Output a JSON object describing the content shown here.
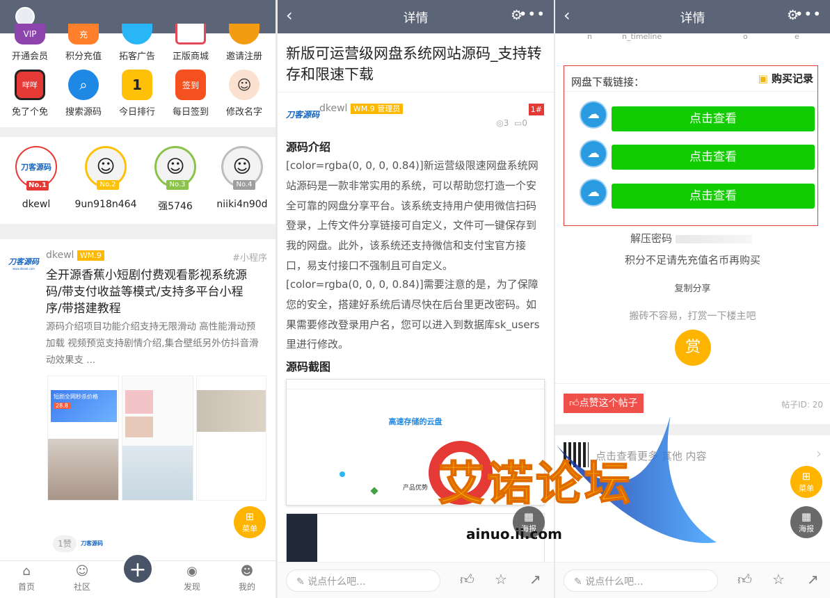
{
  "panel1": {
    "grid_row1": [
      "开通会员",
      "积分充值",
      "拓客广告",
      "正版商城",
      "邀请注册"
    ],
    "grid_row2": [
      "免了个免",
      "搜索源码",
      "今日排行",
      "每日签到",
      "修改名字"
    ],
    "ranking": [
      {
        "name": "dkewl",
        "no": "No.1",
        "avatar_text": "刀客源码"
      },
      {
        "name": "9un918n464",
        "no": "No.2"
      },
      {
        "name": "强5746",
        "no": "No.3"
      },
      {
        "name": "niiki4n90d",
        "no": "No.4"
      }
    ],
    "post": {
      "author": "dkewl",
      "badge": "WM.9",
      "tag": "#小程序",
      "logo_text": "刀客源码",
      "logo_sub": "www.dkewl.com",
      "title": "全开源香蕉小短剧付费观看影视系统源码/带支付收益等模式/支持多平台小程序/带搭建教程",
      "excerpt": "源码介绍项目功能介绍支持无限滑动 高性能滑动预加载 视频预览支持剧情介绍,集合壁纸另外仿抖音滑动效果支 ...",
      "thumb_banner": "短剧全网秒杀价格",
      "thumb_price": "28.8",
      "like": "1赞"
    },
    "fab_menu": "菜单",
    "tabs": [
      "首页",
      "社区",
      "发现",
      "我的"
    ],
    "tab_add": "+"
  },
  "panel2": {
    "header_title": "详情",
    "title": "新版可运营级网盘系统网站源码_支持转存和限速下载",
    "author": "dkewl",
    "author_badge": "WM.9 管理员",
    "floor": "1#",
    "views": "3",
    "comments": "0",
    "section1": "源码介绍",
    "para1": "[color=rgba(0, 0, 0, 0.84)]新运营级限速网盘系统网站源码是一款非常实用的系统，可以帮助您打造一个安全可靠的网盘分享平台。该系统支持用户使用微信扫码登录，上传文件分享链接可自定义，文件可一键保存到我的网盘。此外，该系统还支持微信和支付宝官方接口，易支付接口不强制且可自定义。",
    "para2": "[color=rgba(0, 0, 0, 0.84)]需要注意的是，为了保障您的安全，搭建好系统后请尽快在后台里更改密码。如果需要修改登录用户名，您可以进入到数据库sk_users里进行修改。",
    "section2": "源码截图",
    "shot_heading": "高速存储的云盘",
    "shot_product": "产品优势",
    "fab_poster": "海报",
    "comment_placeholder": "说点什么吧..."
  },
  "panel3": {
    "header_title": "详情",
    "cols": [
      "n",
      "n_timeline",
      "o",
      "e"
    ],
    "link_label": "网盘下载链接：",
    "buy_record": "购买记录",
    "view_btn": [
      "点击查看",
      "点击查看",
      "点击查看"
    ],
    "unzip": "解压密码",
    "notice": "积分不足请先充值名币再购买",
    "copy_share": "复制分享",
    "tip": "搬砖不容易，打赏一下楼主吧",
    "reward": "赏",
    "like_post": "点赞这个帖子",
    "post_id": "帖子ID: 20",
    "see_more": "点击查看更多 其他 内容",
    "fab_menu": "菜单",
    "fab_poster": "海报",
    "comment_placeholder": "说点什么吧..."
  },
  "watermark": {
    "text": "艾诺论坛",
    "url": "ainuo.ii.com"
  }
}
